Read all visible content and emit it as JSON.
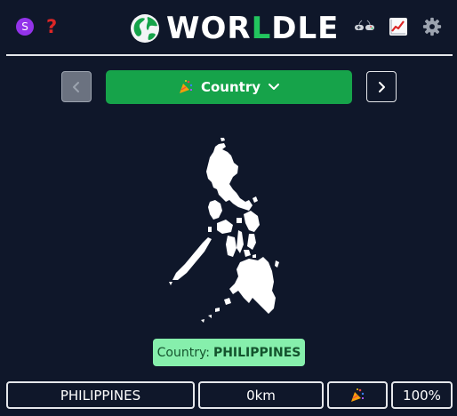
{
  "header": {
    "avatar_letter": "S",
    "help_symbol": "?",
    "logo": {
      "prefix": "WOR",
      "highlight": "L",
      "suffix": "DLE"
    },
    "icons": [
      "avatar-icon",
      "help-icon",
      "globe-icon",
      "game-controllers-icon",
      "stats-chart-icon",
      "gear-icon"
    ]
  },
  "selector": {
    "label": "Country",
    "icon": "party-popper-icon",
    "prev_icon": "chevron-left-icon",
    "next_icon": "chevron-right-icon",
    "dropdown_icon": "chevron-down-icon"
  },
  "answer": {
    "prefix": "Country:",
    "name": "PHILIPPINES"
  },
  "result": {
    "guess": "PHILIPPINES",
    "distance": "0km",
    "direction_icon": "party-popper-icon",
    "proximity": "100%"
  },
  "colors": {
    "background": "#0f172a",
    "accent_green": "#16a34a",
    "answer_bg": "#86efac",
    "help_red": "#dc2626",
    "avatar_purple": "#9333ea"
  }
}
